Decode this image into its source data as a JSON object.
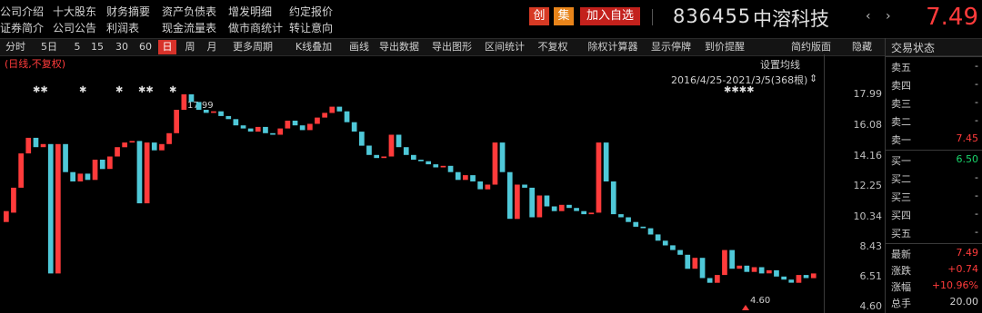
{
  "menu": [
    {
      "label": "公司介绍"
    },
    {
      "label": "十大股东"
    },
    {
      "label": "财务摘要"
    },
    {
      "label": "资产负债表"
    },
    {
      "label": "增发明细"
    },
    {
      "label": "约定报价"
    },
    {
      "label": "证券简介"
    },
    {
      "label": "公司公告"
    },
    {
      "label": "利润表"
    },
    {
      "label": "现金流量表"
    },
    {
      "label": "做市商统计"
    },
    {
      "label": "转让意向"
    }
  ],
  "header": {
    "badge_chuang": "创",
    "badge_ji": "集",
    "add_watchlist": "加入自选",
    "code": "836455",
    "name": "中溶科技",
    "nav_prev": "‹",
    "nav_next": "›",
    "price": "7.49"
  },
  "toolbar": [
    "分时",
    "5日",
    "5",
    "15",
    "30",
    "60",
    "日",
    "周",
    "月",
    "更多周期",
    "K线叠加",
    "画线",
    "导出数据",
    "导出图形",
    "区间统计",
    "不复权",
    "除权计算器",
    "显示停牌",
    "到价提醒",
    "简约版面",
    "隐藏"
  ],
  "toolbar_active": "日",
  "chart": {
    "label": "(日线,不复权)",
    "ma_button": "设置均线",
    "range": "2016/4/25-2021/3/5(368根)",
    "range_arrow": "⇕",
    "high_label": "17.99",
    "low_label": "4.60",
    "markers": "✱✱"
  },
  "chart_data": {
    "type": "candlestick",
    "y_axis": [
      "17.99",
      "16.08",
      "14.16",
      "12.25",
      "10.34",
      "8.43",
      "6.51",
      "4.60"
    ],
    "ylim": [
      4.6,
      17.99
    ],
    "up_color": "#ff3b3b",
    "down_color": "#4fc8d8",
    "max": 17.99,
    "min": 4.6,
    "points": [
      [
        9.8,
        10.5
      ],
      [
        10.4,
        12.0
      ],
      [
        12.0,
        14.2
      ],
      [
        14.2,
        15.2
      ],
      [
        15.2,
        14.6
      ],
      [
        14.6,
        14.8
      ],
      [
        14.8,
        6.5
      ],
      [
        6.5,
        14.8
      ],
      [
        14.8,
        13.0
      ],
      [
        13.0,
        12.4
      ],
      [
        12.4,
        12.9
      ],
      [
        12.9,
        12.5
      ],
      [
        12.5,
        13.8
      ],
      [
        13.8,
        13.2
      ],
      [
        13.2,
        14.0
      ],
      [
        14.0,
        14.6
      ],
      [
        14.6,
        14.9
      ],
      [
        14.9,
        15.0
      ],
      [
        15.0,
        11.0
      ],
      [
        11.0,
        14.9
      ],
      [
        14.9,
        14.4
      ],
      [
        14.4,
        14.8
      ],
      [
        14.8,
        15.5
      ],
      [
        15.5,
        17.0
      ],
      [
        17.0,
        17.99
      ],
      [
        17.99,
        17.5
      ],
      [
        17.5,
        17.0
      ],
      [
        17.0,
        16.8
      ],
      [
        16.8,
        16.9
      ],
      [
        16.9,
        16.6
      ],
      [
        16.6,
        16.4
      ],
      [
        16.4,
        16.0
      ],
      [
        16.0,
        15.8
      ],
      [
        15.8,
        15.6
      ],
      [
        15.6,
        15.9
      ],
      [
        15.9,
        15.5
      ],
      [
        15.5,
        15.4
      ],
      [
        15.4,
        15.8
      ],
      [
        15.8,
        16.3
      ],
      [
        16.3,
        16.0
      ],
      [
        16.0,
        15.7
      ],
      [
        15.7,
        16.1
      ],
      [
        16.1,
        16.5
      ],
      [
        16.5,
        16.8
      ],
      [
        16.8,
        17.2
      ],
      [
        17.2,
        16.9
      ],
      [
        16.9,
        16.2
      ],
      [
        16.2,
        15.6
      ],
      [
        15.6,
        14.7
      ],
      [
        14.7,
        14.1
      ],
      [
        14.1,
        13.9
      ],
      [
        13.9,
        14.0
      ],
      [
        14.0,
        15.4
      ],
      [
        15.4,
        14.6
      ],
      [
        14.6,
        14.1
      ],
      [
        14.1,
        13.8
      ],
      [
        13.8,
        13.7
      ],
      [
        13.7,
        13.5
      ],
      [
        13.5,
        13.3
      ],
      [
        13.3,
        13.4
      ],
      [
        13.4,
        13.0
      ],
      [
        13.0,
        12.5
      ],
      [
        12.5,
        12.8
      ],
      [
        12.8,
        12.4
      ],
      [
        12.4,
        11.9
      ],
      [
        11.9,
        12.2
      ],
      [
        12.2,
        14.9
      ],
      [
        14.9,
        13.0
      ],
      [
        13.0,
        10.0
      ],
      [
        10.0,
        12.2
      ],
      [
        12.2,
        12.0
      ],
      [
        12.0,
        10.1
      ],
      [
        10.1,
        11.5
      ],
      [
        11.5,
        10.8
      ],
      [
        10.8,
        10.5
      ],
      [
        10.5,
        10.9
      ],
      [
        10.9,
        10.7
      ],
      [
        10.7,
        10.5
      ],
      [
        10.5,
        10.3
      ],
      [
        10.3,
        10.4
      ],
      [
        10.4,
        14.9
      ],
      [
        14.9,
        12.4
      ],
      [
        12.4,
        10.3
      ],
      [
        10.3,
        10.1
      ],
      [
        10.1,
        9.8
      ],
      [
        9.8,
        9.5
      ],
      [
        9.5,
        9.4
      ],
      [
        9.4,
        9.0
      ],
      [
        9.0,
        8.6
      ],
      [
        8.6,
        8.3
      ],
      [
        8.3,
        8.0
      ],
      [
        8.0,
        7.7
      ],
      [
        7.7,
        6.8
      ],
      [
        6.8,
        7.5
      ],
      [
        7.5,
        6.2
      ],
      [
        6.2,
        5.9
      ],
      [
        5.9,
        6.4
      ],
      [
        6.4,
        8.0
      ],
      [
        8.0,
        6.8
      ],
      [
        6.8,
        7.0
      ],
      [
        7.0,
        6.6
      ],
      [
        6.6,
        6.9
      ],
      [
        6.9,
        6.5
      ],
      [
        6.5,
        6.7
      ],
      [
        6.7,
        6.3
      ],
      [
        6.3,
        6.1
      ],
      [
        6.1,
        5.9
      ],
      [
        5.9,
        6.4
      ],
      [
        6.4,
        6.2
      ],
      [
        6.2,
        6.5
      ]
    ]
  },
  "right_panel": {
    "title": "交易状态",
    "asks": [
      {
        "label": "卖五",
        "value": "-"
      },
      {
        "label": "卖四",
        "value": "-"
      },
      {
        "label": "卖三",
        "value": "-"
      },
      {
        "label": "卖二",
        "value": "-"
      },
      {
        "label": "卖一",
        "value": "7.45"
      }
    ],
    "bids": [
      {
        "label": "买一",
        "value": "6.50"
      },
      {
        "label": "买二",
        "value": "-"
      },
      {
        "label": "买三",
        "value": "-"
      },
      {
        "label": "买四",
        "value": "-"
      },
      {
        "label": "买五",
        "value": "-"
      }
    ],
    "stats": [
      {
        "label": "最新",
        "value": "7.49"
      },
      {
        "label": "涨跌",
        "value": "+0.74"
      },
      {
        "label": "涨幅",
        "value": "+10.96%"
      },
      {
        "label": "总手",
        "value": "20.00"
      }
    ]
  }
}
